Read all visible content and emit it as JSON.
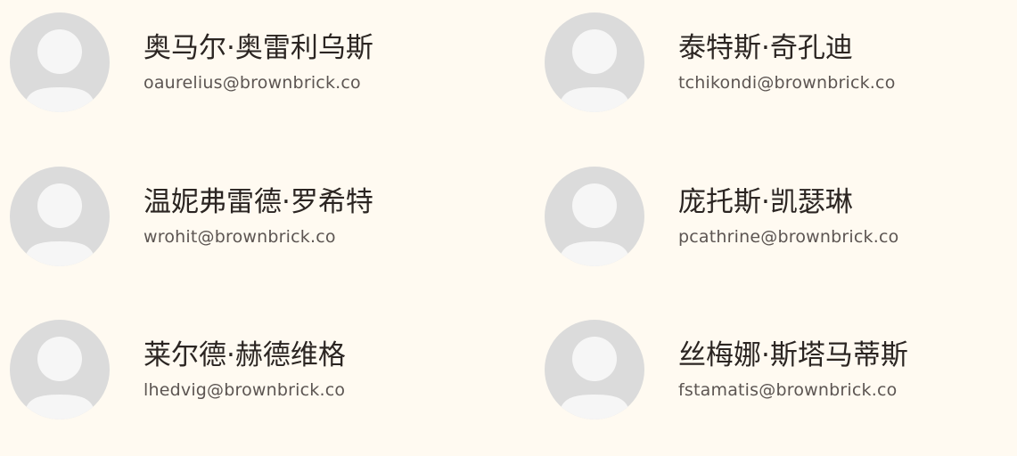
{
  "members": [
    {
      "name": "奥马尔·奥雷利乌斯",
      "email": "oaurelius@brownbrick.co",
      "avatar_icon": "user-avatar-icon"
    },
    {
      "name": "泰特斯·奇孔迪",
      "email": "tchikondi@brownbrick.co",
      "avatar_icon": "user-avatar-icon"
    },
    {
      "name": "温妮弗雷德·罗希特",
      "email": "wrohit@brownbrick.co",
      "avatar_icon": "user-avatar-icon"
    },
    {
      "name": "庞托斯·凯瑟琳",
      "email": "pcathrine@brownbrick.co",
      "avatar_icon": "user-avatar-icon"
    },
    {
      "name": "莱尔德·赫德维格",
      "email": "lhedvig@brownbrick.co",
      "avatar_icon": "user-avatar-icon"
    },
    {
      "name": "丝梅娜·斯塔马蒂斯",
      "email": "fstamatis@brownbrick.co",
      "avatar_icon": "user-avatar-icon"
    }
  ],
  "colors": {
    "background": "#fffaf1",
    "avatar_bg": "#dbdbdb",
    "avatar_fg": "#f6f6f6",
    "name": "#2b2522",
    "email": "#5c5552"
  }
}
